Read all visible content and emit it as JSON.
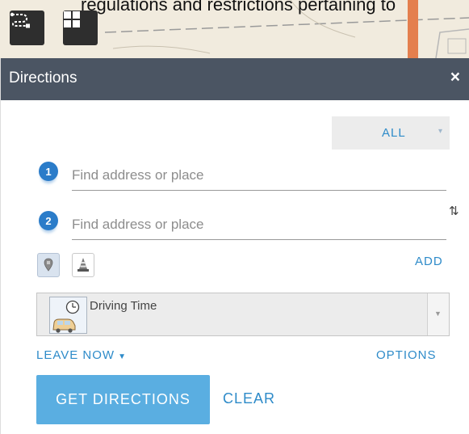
{
  "map": {
    "caption_text": "regulations and restrictions pertaining to",
    "tools": {
      "directions_icon": "route-directions-icon",
      "basemap_icon": "basemap-gallery-icon"
    }
  },
  "panel": {
    "title": "Directions",
    "close_label": "×",
    "travel_mode": {
      "value": "ALL",
      "caret": "▾"
    },
    "stops": [
      {
        "number": "1",
        "placeholder": "Find address or place",
        "value": ""
      },
      {
        "number": "2",
        "placeholder": "Find address or place",
        "value": ""
      }
    ],
    "reverse_label": "⇅",
    "toggles": [
      {
        "icon": "map-pin-icon",
        "active": true
      },
      {
        "icon": "traffic-cone-icon",
        "active": false
      }
    ],
    "add_label": "ADD",
    "impedance": {
      "label": "Driving Time",
      "icon": "driving-time-icon"
    },
    "leave_now_label": "LEAVE NOW",
    "options_label": "OPTIONS",
    "get_directions_label": "GET DIRECTIONS",
    "clear_label": "CLEAR"
  },
  "colors": {
    "header_bg": "#4b5563",
    "accent": "#2e8bc9",
    "primary_button": "#5aaee1",
    "stop_marker": "#2b7cc9"
  }
}
